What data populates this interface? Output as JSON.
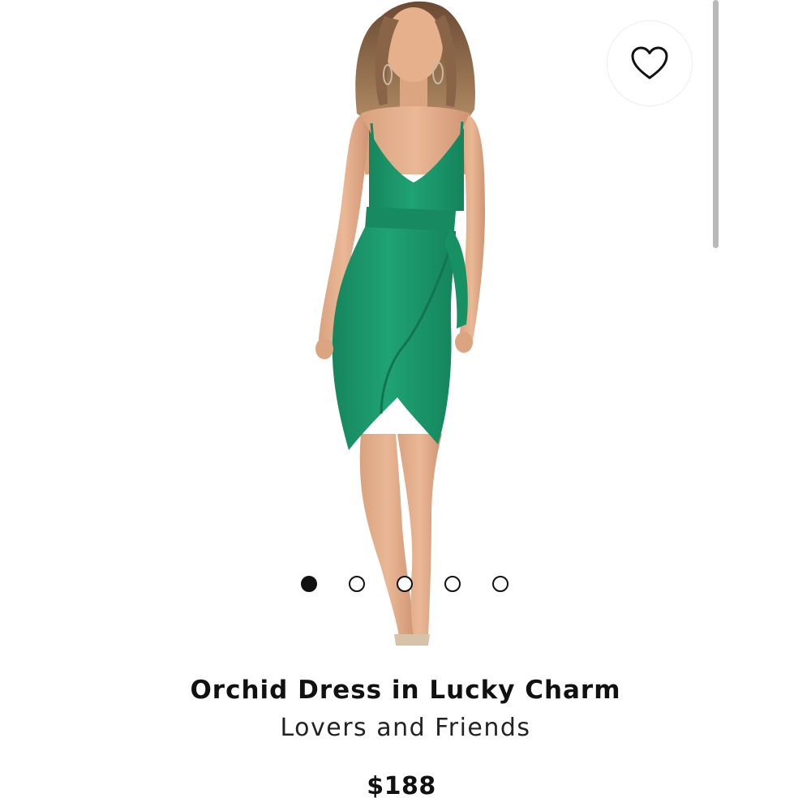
{
  "product": {
    "title": "Orchid Dress in Lucky Charm",
    "brand": "Lovers and Friends",
    "price": "$188"
  },
  "carousel": {
    "total_images": 5,
    "active_index": 0
  },
  "favorite": {
    "icon": "heart-outline-icon",
    "selected": false
  },
  "colors": {
    "dress": "#1c9a6c",
    "background": "#ffffff",
    "text": "#111111"
  }
}
